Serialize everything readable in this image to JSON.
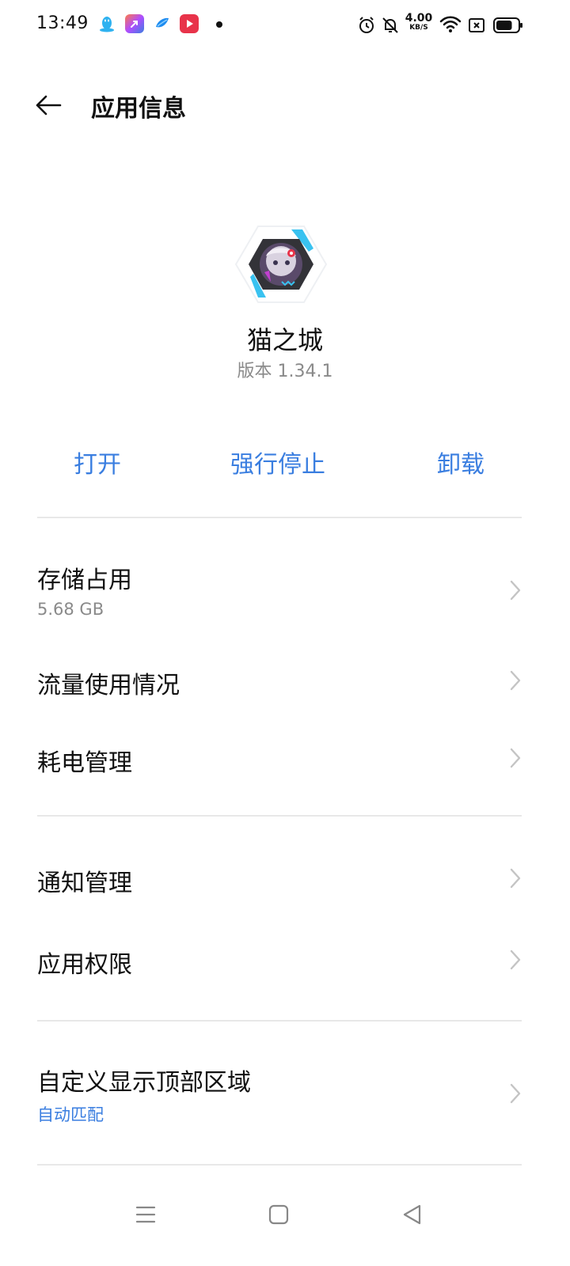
{
  "status_bar": {
    "time": "13:49",
    "net_speed_value": "4.00",
    "net_speed_unit": "KB/S",
    "app_icons": [
      "qq-icon",
      "app-launcher-icon",
      "bird-app-icon",
      "video-app-icon"
    ],
    "right_icons": [
      "alarm-icon",
      "notifications-off-icon",
      "wifi-icon",
      "sim-none-icon",
      "battery-icon"
    ],
    "battery_level": 0.75
  },
  "header": {
    "title": "应用信息"
  },
  "app": {
    "name": "猫之城",
    "version": "版本 1.34.1"
  },
  "actions": {
    "open": "打开",
    "force_stop": "强行停止",
    "uninstall": "卸载"
  },
  "list": {
    "storage": {
      "title": "存储占用",
      "value": "5.68 GB"
    },
    "data_usage": {
      "title": "流量使用情况"
    },
    "power": {
      "title": "耗电管理"
    },
    "notifications": {
      "title": "通知管理"
    },
    "permissions": {
      "title": "应用权限"
    },
    "display_area": {
      "title": "自定义显示顶部区域",
      "value": "自动匹配"
    }
  },
  "nav_bar": {
    "icons": [
      "menu-icon",
      "home-icon",
      "back-nav-icon"
    ]
  },
  "colors": {
    "accent": "#3a7ee0",
    "divider": "#e8e8e8",
    "secondary_text": "#8a8a8a"
  }
}
